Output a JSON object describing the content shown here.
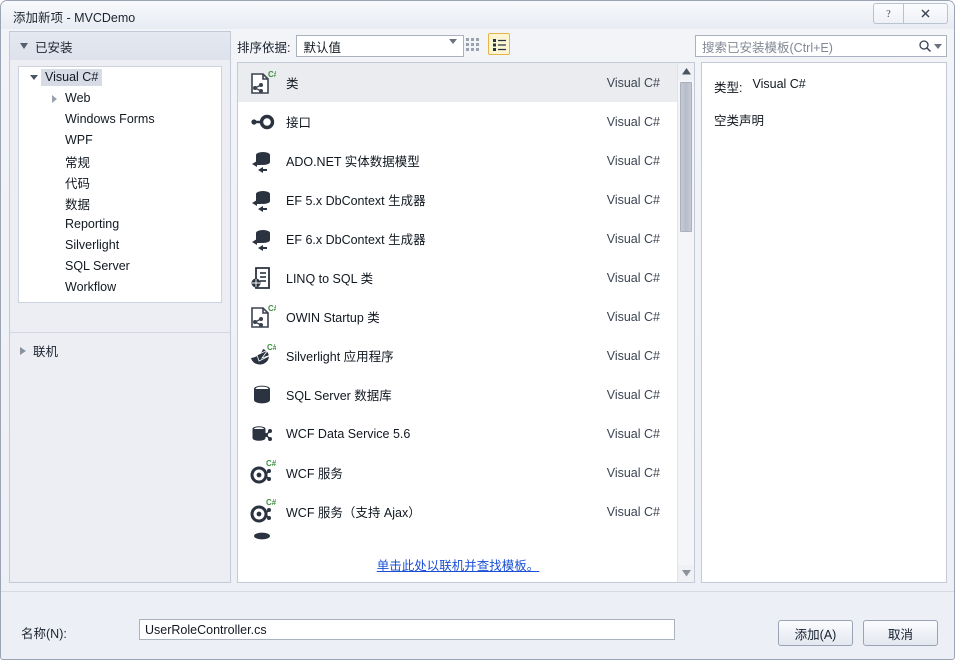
{
  "window": {
    "title": "添加新项 - MVCDemo",
    "help_button": "?",
    "close_button": "✕"
  },
  "sidebar": {
    "header": "已安装",
    "tree": [
      {
        "label": "Visual C#",
        "level": 1,
        "arrow": "down",
        "selected": true
      },
      {
        "label": "Web",
        "level": 2,
        "arrow": "right",
        "selected": false
      },
      {
        "label": "Windows Forms",
        "level": 2,
        "arrow": "none",
        "selected": false
      },
      {
        "label": "WPF",
        "level": 2,
        "arrow": "none",
        "selected": false
      },
      {
        "label": "常规",
        "level": 2,
        "arrow": "none",
        "selected": false
      },
      {
        "label": "代码",
        "level": 2,
        "arrow": "none",
        "selected": false
      },
      {
        "label": "数据",
        "level": 2,
        "arrow": "none",
        "selected": false
      },
      {
        "label": "Reporting",
        "level": 2,
        "arrow": "none",
        "selected": false
      },
      {
        "label": "Silverlight",
        "level": 2,
        "arrow": "none",
        "selected": false
      },
      {
        "label": "SQL Server",
        "level": 2,
        "arrow": "none",
        "selected": false
      },
      {
        "label": "Workflow",
        "level": 2,
        "arrow": "none",
        "selected": false
      }
    ],
    "online_label": "联机"
  },
  "toolbar": {
    "sort_label": "排序依据:",
    "sort_value": "默认值",
    "grid_view_icon": "grid-view-icon",
    "list_view_icon": "list-view-icon",
    "list_view_active": true
  },
  "search": {
    "placeholder": "搜索已安装模板(Ctrl+E)",
    "icon": "search-icon",
    "dropdown_icon": "chevron-down-icon"
  },
  "templates": {
    "items": [
      {
        "name": "类",
        "lang": "Visual C#",
        "icon": "csharp-class-icon",
        "selected": true
      },
      {
        "name": "接口",
        "lang": "Visual C#",
        "icon": "interface-icon",
        "selected": false
      },
      {
        "name": "ADO.NET 实体数据模型",
        "lang": "Visual C#",
        "icon": "database-model-icon",
        "selected": false
      },
      {
        "name": "EF 5.x DbContext 生成器",
        "lang": "Visual C#",
        "icon": "database-model-icon",
        "selected": false
      },
      {
        "name": "EF 6.x DbContext 生成器",
        "lang": "Visual C#",
        "icon": "database-model-icon",
        "selected": false
      },
      {
        "name": "LINQ to SQL 类",
        "lang": "Visual C#",
        "icon": "linq-sql-icon",
        "selected": false
      },
      {
        "name": "OWIN Startup 类",
        "lang": "Visual C#",
        "icon": "csharp-class-icon",
        "selected": false
      },
      {
        "name": "Silverlight 应用程序",
        "lang": "Visual C#",
        "icon": "silverlight-icon",
        "selected": false
      },
      {
        "name": "SQL Server 数据库",
        "lang": "Visual C#",
        "icon": "database-icon",
        "selected": false
      },
      {
        "name": "WCF Data Service 5.6",
        "lang": "Visual C#",
        "icon": "wcf-data-icon",
        "selected": false
      },
      {
        "name": "WCF 服务",
        "lang": "Visual C#",
        "icon": "wcf-service-icon",
        "selected": false
      },
      {
        "name": "WCF 服务（支持 Ajax）",
        "lang": "Visual C#",
        "icon": "wcf-service-icon",
        "selected": false
      }
    ],
    "online_link": "单击此处以联机并查找模板。"
  },
  "details": {
    "type_label": "类型:",
    "type_value": "Visual C#",
    "description": "空类声明"
  },
  "footer": {
    "name_label": "名称(N):",
    "name_value": "UserRoleController.cs",
    "add_button": "添加(A)",
    "cancel_button": "取消"
  },
  "colors": {
    "accent_highlight": "#fdf6d3",
    "accent_border": "#e8b44a",
    "link": "#1a4fd6",
    "selection": "#eaecef",
    "csharp_badge": "#3f8f3f"
  }
}
